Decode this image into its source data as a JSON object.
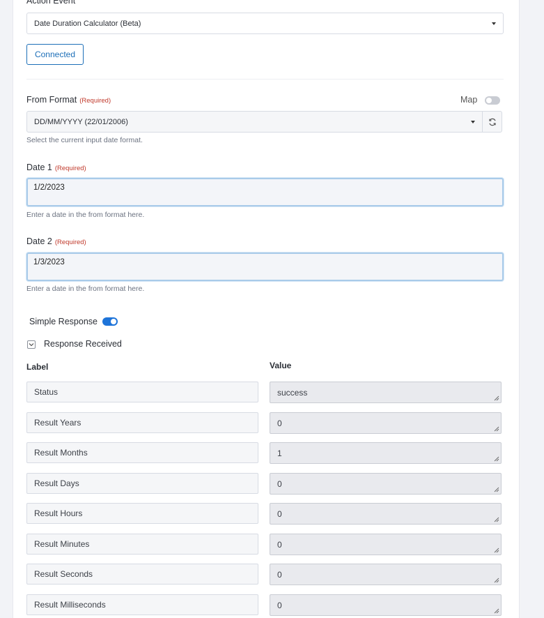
{
  "action_event": {
    "label": "Action Event",
    "selected": "Date Duration Calculator (Beta)"
  },
  "connected_button": "Connected",
  "from_format": {
    "label": "From Format",
    "required": "(Required)",
    "map_label": "Map",
    "selected": "DD/MM/YYYY (22/01/2006)",
    "help": "Select the current input date format."
  },
  "date1": {
    "label": "Date 1",
    "required": "(Required)",
    "value": "1/2/2023",
    "help": "Enter a date in the from format here."
  },
  "date2": {
    "label": "Date 2",
    "required": "(Required)",
    "value": "1/3/2023",
    "help": "Enter a date in the from format here."
  },
  "simple_response": {
    "label": "Simple Response",
    "enabled": true
  },
  "response_received": {
    "label": "Response Received"
  },
  "response_table": {
    "label_header": "Label",
    "value_header": "Value",
    "rows": [
      {
        "label": "Status",
        "value": "success"
      },
      {
        "label": "Result Years",
        "value": "0"
      },
      {
        "label": "Result Months",
        "value": "1"
      },
      {
        "label": "Result Days",
        "value": "0"
      },
      {
        "label": "Result Hours",
        "value": "0"
      },
      {
        "label": "Result Minutes",
        "value": "0"
      },
      {
        "label": "Result Seconds",
        "value": "0"
      },
      {
        "label": "Result Milliseconds",
        "value": "0"
      }
    ]
  },
  "colors": {
    "accent": "#1e74d9",
    "required": "#c0392b",
    "focus_border": "#a9cbe9"
  }
}
